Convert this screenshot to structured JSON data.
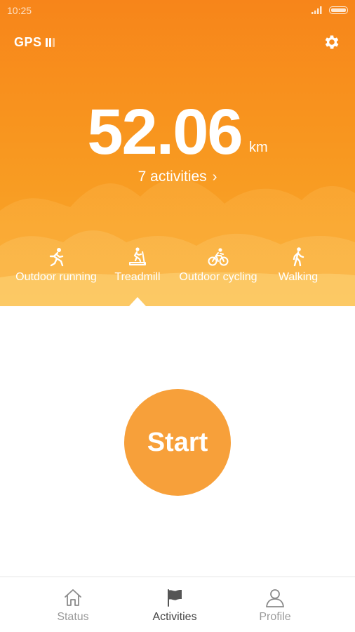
{
  "status_bar": {
    "time": "10:25"
  },
  "header": {
    "gps_label": "GPS",
    "settings_icon": "gear-icon"
  },
  "summary": {
    "distance": "52.06",
    "unit": "km",
    "activities_link": "7 activities"
  },
  "modes": [
    {
      "label": "Outdoor running",
      "icon": "running-icon"
    },
    {
      "label": "Treadmill",
      "icon": "treadmill-icon",
      "selected": true
    },
    {
      "label": "Outdoor cycling",
      "icon": "cycling-icon"
    },
    {
      "label": "Walking",
      "icon": "walking-icon"
    }
  ],
  "start_label": "Start",
  "tabs": [
    {
      "label": "Status",
      "icon": "home-icon"
    },
    {
      "label": "Activities",
      "icon": "flag-icon",
      "active": true
    },
    {
      "label": "Profile",
      "icon": "person-icon"
    }
  ],
  "colors": {
    "accent": "#f7a03a",
    "hero_top": "#f7851a",
    "hero_bottom": "#f9ab2c"
  }
}
